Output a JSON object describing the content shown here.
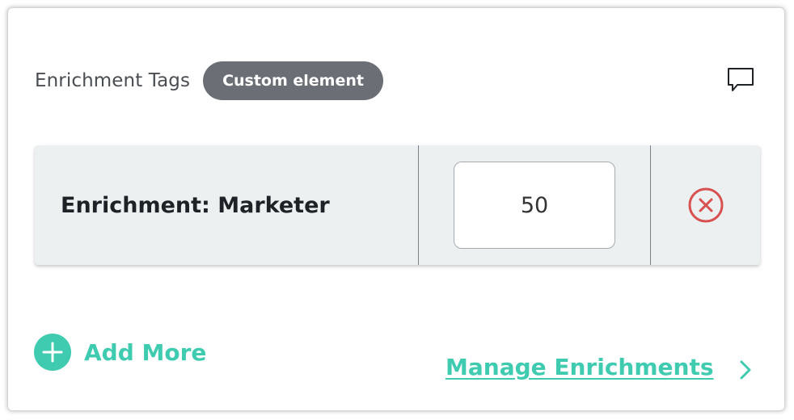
{
  "header": {
    "title": "Enrichment Tags",
    "badge": "Custom element"
  },
  "icons": {
    "comment": "comment-icon",
    "remove": "close-circle-icon",
    "add": "plus-circle-icon",
    "chevron": "chevron-right-icon"
  },
  "rows": [
    {
      "label": "Enrichment: Marketer",
      "value": "50"
    }
  ],
  "actions": {
    "add_more": "Add More",
    "manage": "Manage Enrichments"
  },
  "colors": {
    "accent": "#3ecbb0",
    "badge_bg": "#6b6f75",
    "remove": "#d85050",
    "row_bg": "#edf0f1"
  }
}
